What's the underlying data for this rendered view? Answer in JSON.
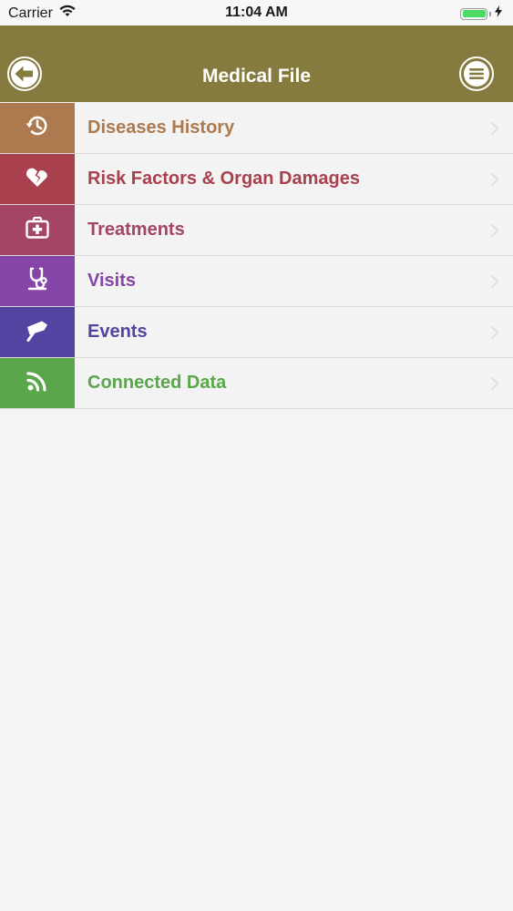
{
  "status_bar": {
    "carrier": "Carrier",
    "time": "11:04 AM",
    "battery_color": "#4cd964"
  },
  "nav": {
    "title": "Medical File",
    "background": "#867b3f",
    "back_icon": "arrow-left-icon",
    "menu_icon": "hamburger-icon"
  },
  "menu": {
    "items": [
      {
        "label": "Diseases History",
        "icon": "history-icon",
        "color": "#ac7a4e"
      },
      {
        "label": "Risk Factors & Organ Damages",
        "icon": "broken-heart-icon",
        "color": "#a8404d"
      },
      {
        "label": "Treatments",
        "icon": "first-aid-kit-icon",
        "color": "#a44563"
      },
      {
        "label": "Visits",
        "icon": "stethoscope-icon",
        "color": "#8444a8"
      },
      {
        "label": "Events",
        "icon": "signpost-icon",
        "color": "#5244a0"
      },
      {
        "label": "Connected Data",
        "icon": "rss-icon",
        "color": "#5aa64a"
      }
    ]
  }
}
